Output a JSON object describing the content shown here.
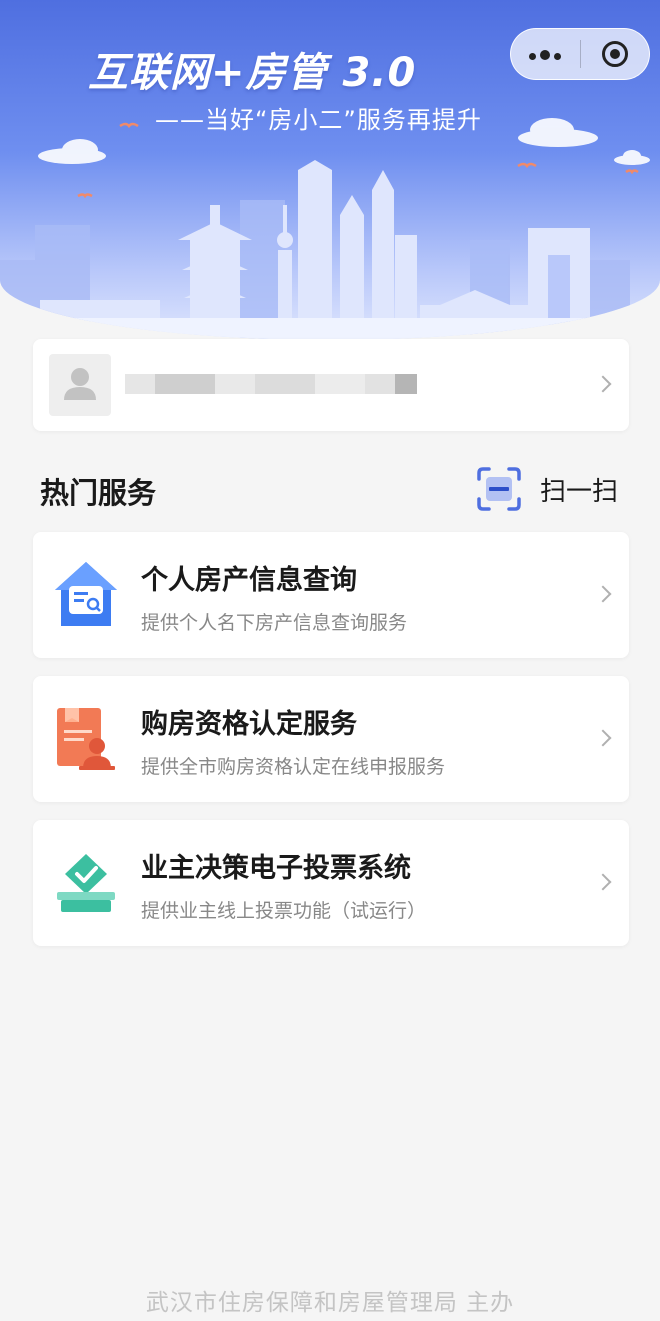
{
  "banner": {
    "title": "互联网+房管 3.0",
    "subtitle": "——当好“房小二”服务再提升"
  },
  "capsule": {
    "more_icon": "more-dots-icon",
    "close_icon": "close-target-icon"
  },
  "user": {
    "avatar_icon": "user-avatar-icon",
    "name": ""
  },
  "hot_services": {
    "title": "热门服务",
    "scan_label": "扫一扫",
    "scan_icon": "scan-icon",
    "items": [
      {
        "title": "个人房产信息查询",
        "desc": "提供个人名下房产信息查询服务",
        "icon": "house-search-icon",
        "color": "#3d7cf2"
      },
      {
        "title": "购房资格认定服务",
        "desc": "提供全市购房资格认定在线申报服务",
        "icon": "qualification-document-icon",
        "color": "#f27a55"
      },
      {
        "title": "业主决策电子投票系统",
        "desc": "提供业主线上投票功能（试运行）",
        "icon": "ballot-box-icon",
        "color": "#3cbfa0"
      }
    ]
  },
  "footer": {
    "text": "武汉市住房保障和房屋管理局 主办"
  },
  "colors": {
    "accent": "#4f6fe0",
    "page_bg": "#f5f5f5",
    "muted_text": "#888888"
  }
}
